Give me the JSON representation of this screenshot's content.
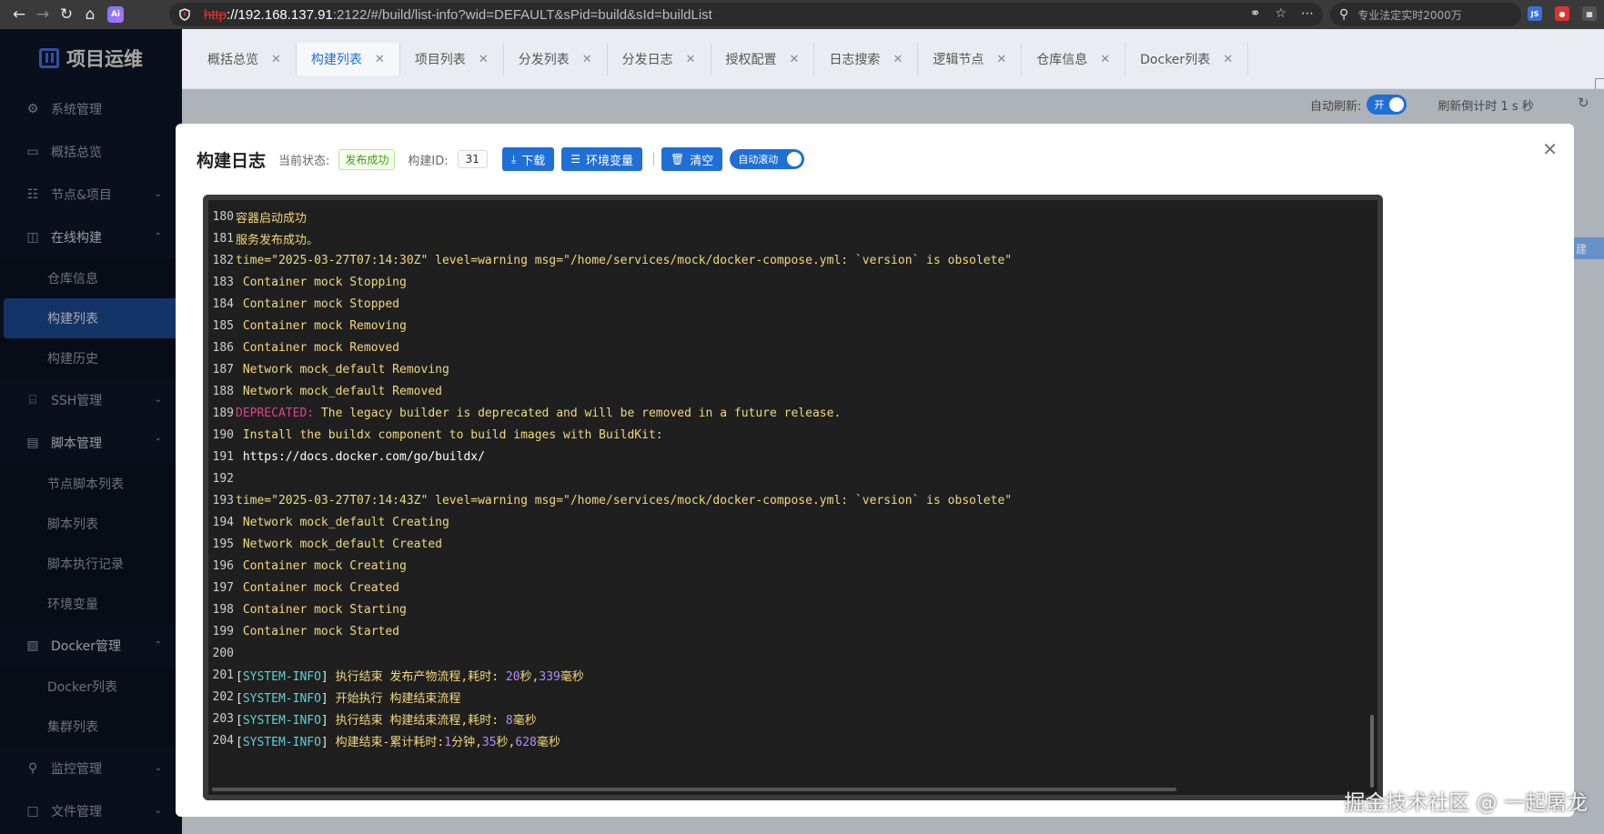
{
  "browser": {
    "url_protocol": "http",
    "url_host": "://192.168.137.91",
    "url_rest": ":2122/#/build/list-info?wid=DEFAULT&sPid=build&sId=buildList",
    "search_placeholder": "专业法定实时2000万"
  },
  "sidebar": {
    "logo": "项目运维",
    "items": [
      {
        "label": "系统管理"
      },
      {
        "label": "概括总览"
      },
      {
        "label": "节点&项目"
      },
      {
        "label": "在线构建"
      },
      {
        "label": "SSH管理"
      },
      {
        "label": "脚本管理"
      },
      {
        "label": "Docker管理"
      },
      {
        "label": "监控管理"
      },
      {
        "label": "文件管理"
      }
    ],
    "build_sub": [
      "仓库信息",
      "构建列表",
      "构建历史"
    ],
    "script_sub": [
      "节点脚本列表",
      "脚本列表",
      "脚本执行记录",
      "环境变量"
    ],
    "docker_sub": [
      "Docker列表",
      "集群列表"
    ]
  },
  "tabs": [
    "概括总览",
    "构建列表",
    "项目列表",
    "分发列表",
    "分发日志",
    "授权配置",
    "日志搜索",
    "逻辑节点",
    "仓库信息",
    "Docker列表"
  ],
  "page": {
    "auto_refresh_label": "自动刷新:",
    "auto_refresh_state": "开",
    "countdown": "刷新倒计时 1 s 秒",
    "bg_button": "建"
  },
  "modal": {
    "title": "构建日志",
    "status_label": "当前状态:",
    "status_value": "发布成功",
    "build_id_label": "构建ID:",
    "build_id": "31",
    "download": "下载",
    "env_vars": "环境变量",
    "clear": "清空",
    "auto_scroll": "自动滚动"
  },
  "log": [
    {
      "n": "180",
      "t": "容器启动成功"
    },
    {
      "n": "181",
      "t": "服务发布成功。"
    },
    {
      "n": "182",
      "t": "time=\"2025-03-27T07:14:30Z\" level=warning msg=\"/home/services/mock/docker-compose.yml: `version` is obsolete\""
    },
    {
      "n": "183",
      "t": " Container mock Stopping"
    },
    {
      "n": "184",
      "t": " Container mock Stopped"
    },
    {
      "n": "185",
      "t": " Container mock Removing"
    },
    {
      "n": "186",
      "t": " Container mock Removed"
    },
    {
      "n": "187",
      "t": " Network mock_default Removing"
    },
    {
      "n": "188",
      "t": " Network mock_default Removed"
    },
    {
      "n": "189",
      "dep": "DEPRECATED:",
      "t": " The legacy builder is deprecated and will be removed in a future release."
    },
    {
      "n": "190",
      "t": " Install the buildx component to build images with BuildKit:"
    },
    {
      "n": "191",
      "t": " https://docs.docker.com/go/buildx/",
      "url": true
    },
    {
      "n": "192",
      "t": ""
    },
    {
      "n": "193",
      "t": "time=\"2025-03-27T07:14:43Z\" level=warning msg=\"/home/services/mock/docker-compose.yml: `version` is obsolete\""
    },
    {
      "n": "194",
      "t": " Network mock_default Creating"
    },
    {
      "n": "195",
      "t": " Network mock_default Created"
    },
    {
      "n": "196",
      "t": " Container mock Creating"
    },
    {
      "n": "197",
      "t": " Container mock Created"
    },
    {
      "n": "198",
      "t": " Container mock Starting"
    },
    {
      "n": "199",
      "t": " Container mock Started"
    },
    {
      "n": "200",
      "t": ""
    },
    {
      "n": "201",
      "sys": true,
      "a": "执行结束 发布产物流程,耗时: ",
      "b": "20",
      "c": "秒,",
      "d": "339",
      "e": "毫秒"
    },
    {
      "n": "202",
      "sys": true,
      "a": "开始执行 构建结束流程",
      "b": "",
      "c": "",
      "d": "",
      "e": ""
    },
    {
      "n": "203",
      "sys": true,
      "a": "执行结束 构建结束流程,耗时: ",
      "b": "8",
      "c": "毫秒",
      "d": "",
      "e": ""
    },
    {
      "n": "204",
      "sys": true,
      "a": "构建结束-累计耗时:",
      "b": "1",
      "c": "分钟,",
      "d": "35",
      "e": "秒,",
      "f": "628",
      "g": "毫秒"
    }
  ],
  "watermark": "掘金技术社区 @ 一起屠龙"
}
